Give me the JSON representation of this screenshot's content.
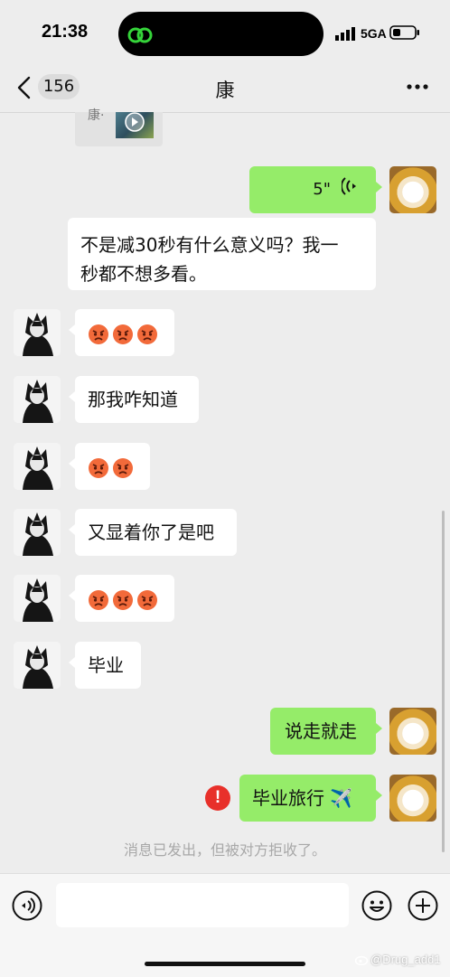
{
  "status_bar": {
    "time": "21:38",
    "network": "5GA"
  },
  "nav": {
    "unread_count": "156",
    "title": "康"
  },
  "top_card": {
    "text_fragment": "康·"
  },
  "messages": [
    {
      "id": "voice",
      "side": "out",
      "type": "voice",
      "duration": "5\""
    },
    {
      "id": "m1",
      "side": "out",
      "type": "text",
      "text_line1": "不是减30秒有什么意义吗？我一",
      "text_line2": "秒都不想多看。"
    },
    {
      "id": "m2",
      "side": "in",
      "type": "emoji",
      "emoji": "angry-face",
      "count": 3
    },
    {
      "id": "m3",
      "side": "in",
      "type": "text",
      "text": "那我咋知道"
    },
    {
      "id": "m4",
      "side": "in",
      "type": "emoji",
      "emoji": "angry-face",
      "count": 2
    },
    {
      "id": "m5",
      "side": "in",
      "type": "text",
      "text": "又显着你了是吧"
    },
    {
      "id": "m6",
      "side": "in",
      "type": "emoji",
      "emoji": "angry-face",
      "count": 3
    },
    {
      "id": "m7",
      "side": "in",
      "type": "text",
      "text": "毕业"
    },
    {
      "id": "m8",
      "side": "out",
      "type": "text",
      "text": "说走就走"
    },
    {
      "id": "m9",
      "side": "out",
      "type": "text",
      "text": "毕业旅行 ✈️",
      "failed": true
    }
  ],
  "error_mark": "!",
  "system_notice": "消息已发出，但被对方拒收了。",
  "watermark": "@Drug_add1",
  "icons": {
    "island": "link-icon",
    "back": "chevron-left-icon",
    "more": "more-dots-icon",
    "voice": "voice-input-icon",
    "emoji": "smile-icon",
    "plus": "plus-icon"
  },
  "colors": {
    "outgoing_bubble": "#95ec69",
    "incoming_bubble": "#ffffff",
    "error": "#e8302a",
    "background": "#ededed"
  }
}
